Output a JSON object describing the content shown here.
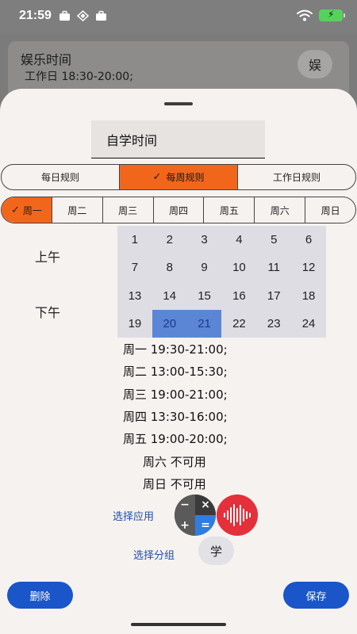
{
  "status_bar": {
    "time": "21:59"
  },
  "background_card": {
    "title": "娱乐时间",
    "subtitle": "工作日 18:30-20:00;",
    "avatar": "娱"
  },
  "name_field": {
    "value": "自学时间"
  },
  "rule_tabs": [
    {
      "label": "每日规则",
      "active": false
    },
    {
      "label": "每周规则",
      "active": true
    },
    {
      "label": "工作日规则",
      "active": false
    }
  ],
  "day_tabs": [
    {
      "label": "周一",
      "active": true
    },
    {
      "label": "周二",
      "active": false
    },
    {
      "label": "周三",
      "active": false
    },
    {
      "label": "周四",
      "active": false
    },
    {
      "label": "周五",
      "active": false
    },
    {
      "label": "周六",
      "active": false
    },
    {
      "label": "周日",
      "active": false
    }
  ],
  "periods": {
    "am": "上午",
    "pm": "下午"
  },
  "hour_grid": {
    "hours": [
      "1",
      "2",
      "3",
      "4",
      "5",
      "6",
      "7",
      "8",
      "9",
      "10",
      "11",
      "12",
      "13",
      "14",
      "15",
      "16",
      "17",
      "18",
      "19",
      "20",
      "21",
      "22",
      "23",
      "24"
    ],
    "selected": [
      "20",
      "21"
    ]
  },
  "schedule": [
    "周一 19:30-21:00;",
    "周二 13:00-15:30;",
    "周三 19:00-21:00;",
    "周四 13:30-16:00;",
    "周五 19:00-20:00;",
    "周六 不可用",
    "周日 不可用"
  ],
  "select_app": {
    "label": "选择应用",
    "apps": [
      "calculator-icon",
      "voice-memo-icon"
    ]
  },
  "select_group": {
    "label": "选择分组",
    "avatar": "学"
  },
  "buttons": {
    "delete": "删除",
    "save": "保存"
  },
  "colors": {
    "accent_orange": "#f2661c",
    "button_blue": "#1a55c9",
    "selected_hour": "#5b86d6",
    "link_blue": "#1f4fa8"
  }
}
